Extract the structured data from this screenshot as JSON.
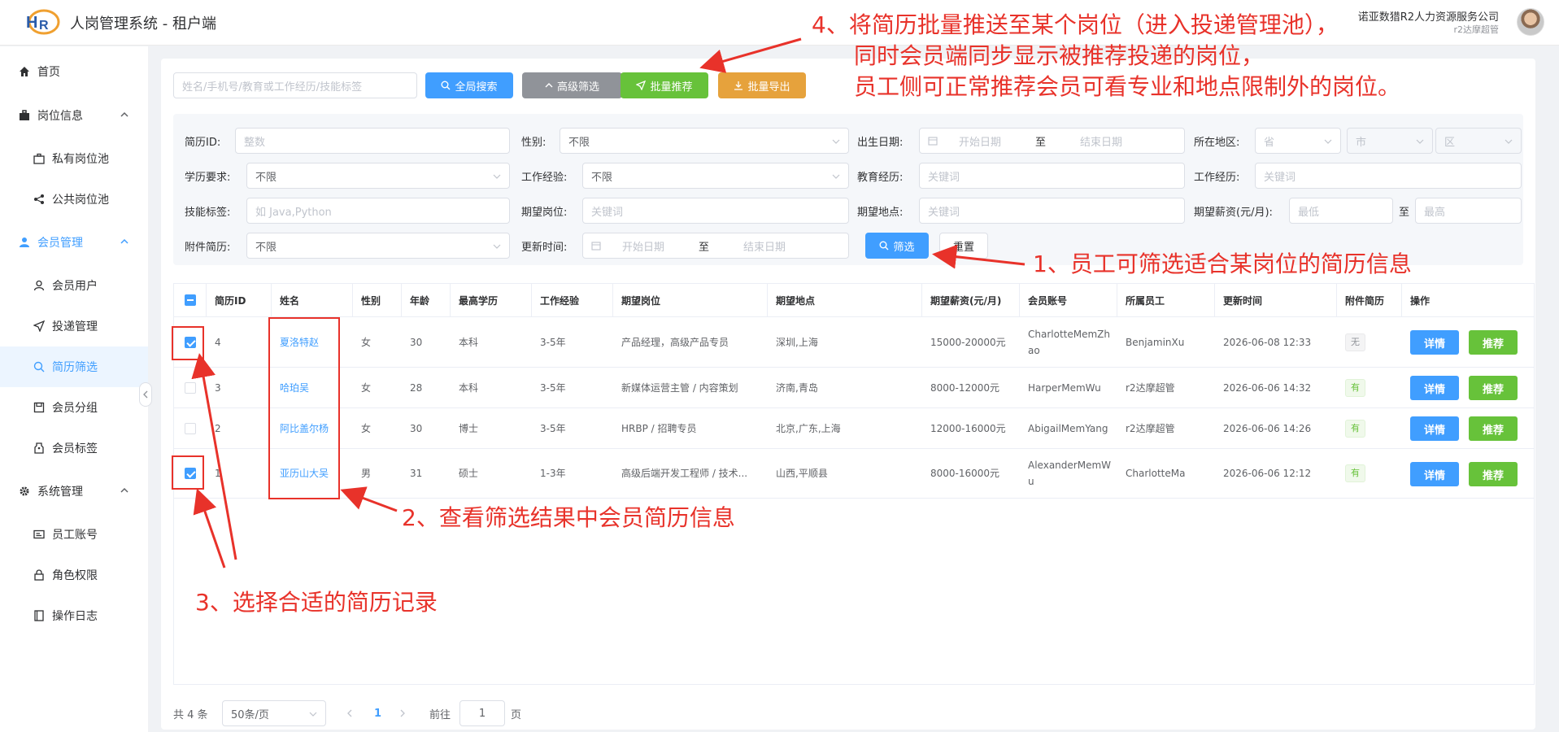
{
  "app": {
    "title": "人岗管理系统 - 租户端",
    "company": "诺亚数猎R2人力资源服务公司",
    "user": "r2达摩超管"
  },
  "sidebar": {
    "items": [
      {
        "label": "首页",
        "icon": "home-icon"
      },
      {
        "label": "岗位信息",
        "icon": "briefcase-icon"
      },
      {
        "label": "私有岗位池",
        "icon": "case-icon"
      },
      {
        "label": "公共岗位池",
        "icon": "share-icon"
      },
      {
        "label": "会员管理",
        "icon": "user-icon"
      },
      {
        "label": "会员用户",
        "icon": "person-icon"
      },
      {
        "label": "投递管理",
        "icon": "send-icon"
      },
      {
        "label": "简历筛选",
        "icon": "search-icon"
      },
      {
        "label": "会员分组",
        "icon": "save-icon"
      },
      {
        "label": "会员标签",
        "icon": "tag-icon"
      },
      {
        "label": "系统管理",
        "icon": "gear-icon"
      },
      {
        "label": "员工账号",
        "icon": "card-icon"
      },
      {
        "label": "角色权限",
        "icon": "lock-icon"
      },
      {
        "label": "操作日志",
        "icon": "book-icon"
      }
    ]
  },
  "toolbar": {
    "search_placeholder": "姓名/手机号/教育或工作经历/技能标签",
    "global_search": "全局搜索",
    "advanced": "高级筛选",
    "batch_recommend": "批量推荐",
    "batch_export": "批量导出"
  },
  "filters": {
    "resume_id": {
      "label": "简历ID:",
      "placeholder": "整数"
    },
    "gender": {
      "label": "性别:",
      "value": "不限"
    },
    "birth": {
      "label": "出生日期:",
      "start": "开始日期",
      "to": "至",
      "end": "结束日期"
    },
    "region": {
      "label": "所在地区:",
      "province": "省",
      "city": "市",
      "district": "区"
    },
    "education": {
      "label": "学历要求:",
      "value": "不限"
    },
    "work_years": {
      "label": "工作经验:",
      "value": "不限"
    },
    "edu_exp": {
      "label": "教育经历:",
      "placeholder": "关键词"
    },
    "work_exp": {
      "label": "工作经历:",
      "placeholder": "关键词"
    },
    "skills": {
      "label": "技能标签:",
      "placeholder": "如 Java,Python"
    },
    "exp_position": {
      "label": "期望岗位:",
      "placeholder": "关键词"
    },
    "exp_location": {
      "label": "期望地点:",
      "placeholder": "关键词"
    },
    "exp_salary": {
      "label": "期望薪资(元/月):",
      "min": "最低",
      "to": "至",
      "max": "最高"
    },
    "attachment": {
      "label": "附件简历:",
      "value": "不限"
    },
    "update_time": {
      "label": "更新时间:",
      "start": "开始日期",
      "to": "至",
      "end": "结束日期"
    },
    "filter_btn": "筛选",
    "reset_btn": "重置"
  },
  "table": {
    "headers": [
      "简历ID",
      "姓名",
      "性别",
      "年龄",
      "最高学历",
      "工作经验",
      "期望岗位",
      "期望地点",
      "期望薪资(元/月)",
      "会员账号",
      "所属员工",
      "更新时间",
      "附件简历",
      "操作"
    ],
    "rows": [
      {
        "checked": true,
        "id": "4",
        "name": "夏洛特赵",
        "gender": "女",
        "age": "30",
        "edu": "本科",
        "exp": "3-5年",
        "position": "产品经理，高级产品专员",
        "location": "深圳,上海",
        "salary": "15000-20000元",
        "account": "CharlotteMemZhao",
        "staff": "BenjaminXu",
        "updated": "2026-06-08 12:33",
        "attach": "无"
      },
      {
        "checked": false,
        "id": "3",
        "name": "哈珀吴",
        "gender": "女",
        "age": "28",
        "edu": "本科",
        "exp": "3-5年",
        "position": "新媒体运营主管 / 内容策划",
        "location": "济南,青岛",
        "salary": "8000-12000元",
        "account": "HarperMemWu",
        "staff": "r2达摩超管",
        "updated": "2026-06-06 14:32",
        "attach": "有"
      },
      {
        "checked": false,
        "id": "2",
        "name": "阿比盖尔杨",
        "gender": "女",
        "age": "30",
        "edu": "博士",
        "exp": "3-5年",
        "position": "HRBP / 招聘专员",
        "location": "北京,广东,上海",
        "salary": "12000-16000元",
        "account": "AbigailMemYang",
        "staff": "r2达摩超管",
        "updated": "2026-06-06 14:26",
        "attach": "有"
      },
      {
        "checked": true,
        "id": "1",
        "name": "亚历山大吴",
        "gender": "男",
        "age": "31",
        "edu": "硕士",
        "exp": "1-3年",
        "position": "高级后端开发工程师 / 技术...",
        "location": "山西,平顺县",
        "salary": "8000-16000元",
        "account": "AlexanderMemWu",
        "staff": "CharlotteMa",
        "updated": "2026-06-06 12:12",
        "attach": "有"
      }
    ],
    "detail_btn": "详情",
    "recommend_btn": "推荐"
  },
  "pager": {
    "total": "共 4 条",
    "size": "50条/页",
    "current": "1",
    "goto": "前往",
    "goto_value": "1",
    "page_unit": "页"
  },
  "annotations": {
    "a1": "1、员工可筛选适合某岗位的简历信息",
    "a2": "2、查看筛选结果中会员简历信息",
    "a3": "3、选择合适的简历记录",
    "a4_line1": "4、将简历批量推送至某个岗位（进入投递管理池），",
    "a4_line2": "同时会员端同步显示被推荐投递的岗位，",
    "a4_line3": "员工侧可正常推荐会员可看专业和地点限制外的岗位。"
  },
  "colors": {
    "primary": "#409eff",
    "success": "#67c23a",
    "warning": "#e6a23c",
    "info": "#909399",
    "annotation": "#e8322a"
  }
}
